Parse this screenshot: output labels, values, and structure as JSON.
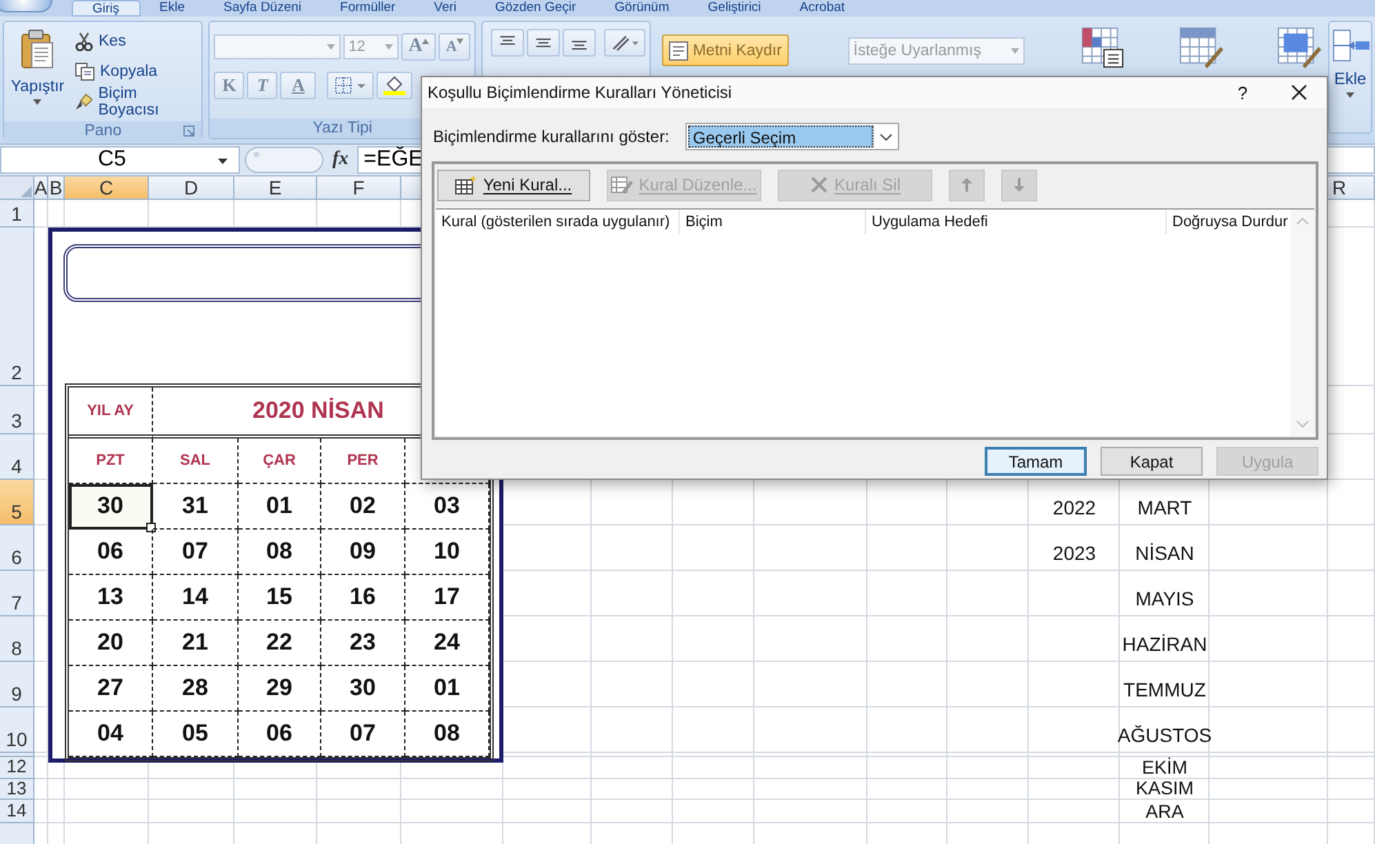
{
  "ribbon": {
    "tabs": [
      {
        "label": "Giriş",
        "selected": true
      },
      {
        "label": "Ekle",
        "selected": false
      },
      {
        "label": "Sayfa Düzeni",
        "selected": false
      },
      {
        "label": "Formüller",
        "selected": false
      },
      {
        "label": "Veri",
        "selected": false
      },
      {
        "label": "Gözden Geçir",
        "selected": false
      },
      {
        "label": "Görünüm",
        "selected": false
      },
      {
        "label": "Geliştirici",
        "selected": false
      },
      {
        "label": "Acrobat",
        "selected": false
      }
    ],
    "clipboard": {
      "paste": "Yapıştır",
      "cut": "Kes",
      "copy": "Kopyala",
      "format_painter": "Biçim Boyacısı",
      "label": "Pano"
    },
    "font": {
      "size": "12",
      "grow": "A",
      "shrink": "A",
      "bold": "K",
      "italic": "T",
      "underline": "A",
      "label": "Yazı Tipi"
    },
    "wrap_text": {
      "label": "Metni Kaydır",
      "on": true
    },
    "number_format": {
      "value": "İsteğe Uyarlanmış",
      "disabled": true
    },
    "insert": "Ekle"
  },
  "formula_bar": {
    "name_box": "C5",
    "function_label": "fx",
    "formula": "=EĞE"
  },
  "sheet": {
    "columns": [
      {
        "label": "A",
        "selected": false
      },
      {
        "label": "B",
        "selected": false
      },
      {
        "label": "C",
        "selected": true
      },
      {
        "label": "D",
        "selected": false
      },
      {
        "label": "E",
        "selected": false
      },
      {
        "label": "F",
        "selected": false
      },
      {
        "label": "R",
        "selected": false
      }
    ],
    "rows": [
      {
        "label": "1",
        "selected": false
      },
      {
        "label": "2",
        "selected": false
      },
      {
        "label": "3",
        "selected": false
      },
      {
        "label": "4",
        "selected": false
      },
      {
        "label": "5",
        "selected": true
      },
      {
        "label": "6",
        "selected": false
      },
      {
        "label": "7",
        "selected": false
      },
      {
        "label": "8",
        "selected": false
      },
      {
        "label": "9",
        "selected": false
      },
      {
        "label": "10",
        "selected": false
      },
      {
        "label": "12",
        "selected": false
      },
      {
        "label": "13",
        "selected": false
      },
      {
        "label": "14",
        "selected": false
      }
    ],
    "years": [
      "2022",
      "2023"
    ],
    "months": [
      "MART",
      "NİSAN",
      "MAYIS",
      "HAZİRAN",
      "TEMMUZ",
      "AĞUSTOS",
      "EKİM",
      "KASIM",
      "ARA"
    ]
  },
  "calendar": {
    "year_month_label": "YIL AY",
    "title": "2020 NİSAN",
    "weekdays": [
      "PZT",
      "SAL",
      "ÇAR",
      "PER"
    ],
    "weeks": [
      {
        "days": [
          {
            "text": "30",
            "selected": true
          },
          {
            "text": "31",
            "selected": false
          },
          {
            "text": "01",
            "selected": false
          },
          {
            "text": "02",
            "selected": false
          },
          {
            "text": "03",
            "selected": false
          }
        ]
      },
      {
        "days": [
          {
            "text": "06",
            "selected": false
          },
          {
            "text": "07",
            "selected": false
          },
          {
            "text": "08",
            "selected": false
          },
          {
            "text": "09",
            "selected": false
          },
          {
            "text": "10",
            "selected": false
          }
        ]
      },
      {
        "days": [
          {
            "text": "13",
            "selected": false
          },
          {
            "text": "14",
            "selected": false
          },
          {
            "text": "15",
            "selected": false
          },
          {
            "text": "16",
            "selected": false
          },
          {
            "text": "17",
            "selected": false
          }
        ]
      },
      {
        "days": [
          {
            "text": "20",
            "selected": false
          },
          {
            "text": "21",
            "selected": false
          },
          {
            "text": "22",
            "selected": false
          },
          {
            "text": "23",
            "selected": false
          },
          {
            "text": "24",
            "selected": false
          }
        ]
      },
      {
        "days": [
          {
            "text": "27",
            "selected": false
          },
          {
            "text": "28",
            "selected": false
          },
          {
            "text": "29",
            "selected": false
          },
          {
            "text": "30",
            "selected": false
          },
          {
            "text": "01",
            "selected": false
          }
        ]
      },
      {
        "days": [
          {
            "text": "04",
            "selected": false
          },
          {
            "text": "05",
            "selected": false
          },
          {
            "text": "06",
            "selected": false
          },
          {
            "text": "07",
            "selected": false
          },
          {
            "text": "08",
            "selected": false
          }
        ]
      }
    ]
  },
  "dialog": {
    "title": "Koşullu Biçimlendirme Kuralları Yöneticisi",
    "help": "?",
    "show_label": "Biçimlendirme kurallarını göster:",
    "scope": "Geçerli Seçim",
    "tools": [
      {
        "kind": "new",
        "label": "Yeni Kural...",
        "disabled": false
      },
      {
        "kind": "edit",
        "label": "Kural Düzenle...",
        "disabled": true
      },
      {
        "kind": "delete",
        "label": "Kuralı Sil",
        "disabled": true
      },
      {
        "kind": "up",
        "disabled": true
      },
      {
        "kind": "down",
        "disabled": true
      }
    ],
    "columns": [
      "Kural (gösterilen sırada uygulanır)",
      "Biçim",
      "Uygulama Hedefi",
      "Doğruysa Durdur"
    ],
    "buttons": [
      {
        "label": "Tamam",
        "default": true,
        "disabled": false
      },
      {
        "label": "Kapat",
        "default": false,
        "disabled": false
      },
      {
        "label": "Uygula",
        "default": false,
        "disabled": true
      }
    ]
  }
}
